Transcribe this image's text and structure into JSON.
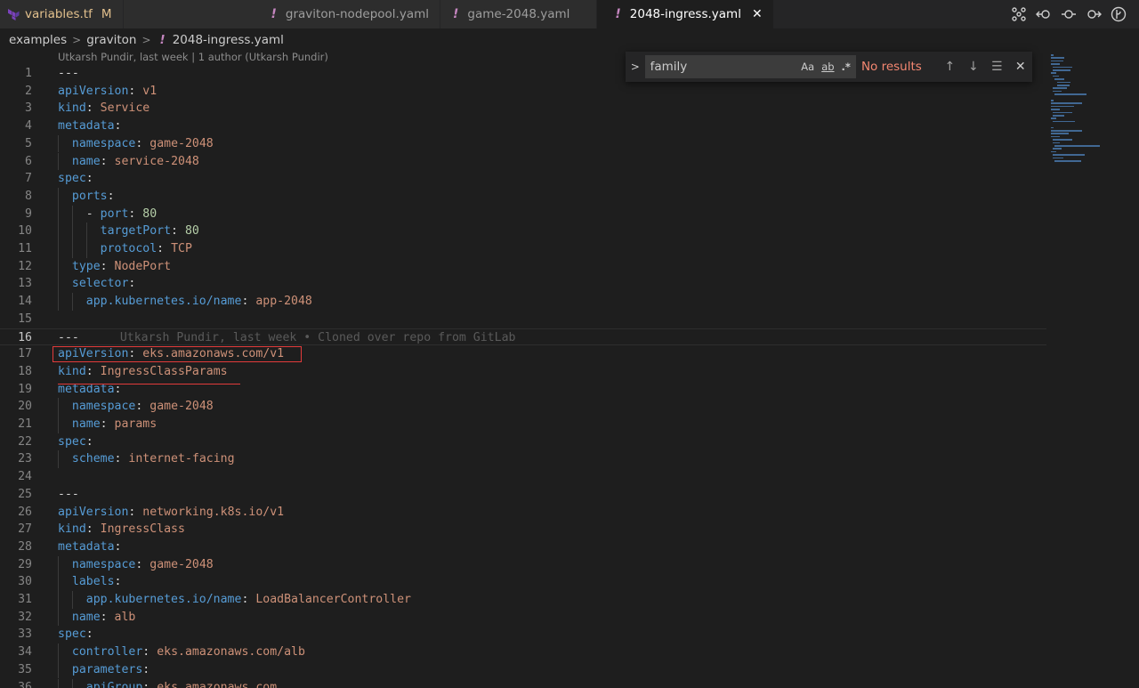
{
  "tabs": [
    {
      "title": "variables.tf",
      "status": "M",
      "icon": "terraform-icon"
    },
    {
      "title": "graviton-nodepool.yaml",
      "icon": "yaml-icon"
    },
    {
      "title": "game-2048.yaml",
      "icon": "yaml-icon"
    },
    {
      "title": "2048-ingress.yaml",
      "icon": "yaml-icon",
      "active": true
    }
  ],
  "tab_tools": [
    "compare-icon",
    "go-back-icon",
    "commit-icon",
    "go-forward-icon",
    "git-branch-icon"
  ],
  "breadcrumb": {
    "items": [
      "examples",
      "graviton",
      "2048-ingress.yaml"
    ]
  },
  "blame_header": "Utkarsh Pundir, last week | 1 author (Utkarsh Pundir)",
  "inline_blame": "Utkarsh Pundir, last week • Cloned over repo from GitLab",
  "find_widget": {
    "query": "family",
    "match_case_label": "Aa",
    "whole_word_label": "ab",
    "regex_label": ".*",
    "result": "No results"
  },
  "colors": {
    "keyword": "#569cd6",
    "string": "#ce9178",
    "number": "#b5cea8",
    "annotation": "#e23b3b"
  },
  "code": [
    {
      "n": "1",
      "parts": [
        {
          "t": "---",
          "c": "d"
        }
      ]
    },
    {
      "n": "2",
      "parts": [
        {
          "t": "apiVersion",
          "c": "k"
        },
        {
          "t": ": ",
          "c": "p"
        },
        {
          "t": "v1",
          "c": "s"
        }
      ]
    },
    {
      "n": "3",
      "parts": [
        {
          "t": "kind",
          "c": "k"
        },
        {
          "t": ": ",
          "c": "p"
        },
        {
          "t": "Service",
          "c": "s"
        }
      ]
    },
    {
      "n": "4",
      "parts": [
        {
          "t": "metadata",
          "c": "k"
        },
        {
          "t": ":",
          "c": "p"
        }
      ]
    },
    {
      "n": "5",
      "parts": [
        {
          "t": "  ",
          "c": "p"
        },
        {
          "t": "namespace",
          "c": "k"
        },
        {
          "t": ": ",
          "c": "p"
        },
        {
          "t": "game-2048",
          "c": "s"
        }
      ]
    },
    {
      "n": "6",
      "parts": [
        {
          "t": "  ",
          "c": "p"
        },
        {
          "t": "name",
          "c": "k"
        },
        {
          "t": ": ",
          "c": "p"
        },
        {
          "t": "service-2048",
          "c": "s"
        }
      ]
    },
    {
      "n": "7",
      "parts": [
        {
          "t": "spec",
          "c": "k"
        },
        {
          "t": ":",
          "c": "p"
        }
      ]
    },
    {
      "n": "8",
      "parts": [
        {
          "t": "  ",
          "c": "p"
        },
        {
          "t": "ports",
          "c": "k"
        },
        {
          "t": ":",
          "c": "p"
        }
      ]
    },
    {
      "n": "9",
      "parts": [
        {
          "t": "    - ",
          "c": "p"
        },
        {
          "t": "port",
          "c": "k"
        },
        {
          "t": ": ",
          "c": "p"
        },
        {
          "t": "80",
          "c": "n"
        }
      ]
    },
    {
      "n": "10",
      "parts": [
        {
          "t": "      ",
          "c": "p"
        },
        {
          "t": "targetPort",
          "c": "k"
        },
        {
          "t": ": ",
          "c": "p"
        },
        {
          "t": "80",
          "c": "n"
        }
      ]
    },
    {
      "n": "11",
      "parts": [
        {
          "t": "      ",
          "c": "p"
        },
        {
          "t": "protocol",
          "c": "k"
        },
        {
          "t": ": ",
          "c": "p"
        },
        {
          "t": "TCP",
          "c": "s"
        }
      ]
    },
    {
      "n": "12",
      "parts": [
        {
          "t": "  ",
          "c": "p"
        },
        {
          "t": "type",
          "c": "k"
        },
        {
          "t": ": ",
          "c": "p"
        },
        {
          "t": "NodePort",
          "c": "s"
        }
      ]
    },
    {
      "n": "13",
      "parts": [
        {
          "t": "  ",
          "c": "p"
        },
        {
          "t": "selector",
          "c": "k"
        },
        {
          "t": ":",
          "c": "p"
        }
      ]
    },
    {
      "n": "14",
      "parts": [
        {
          "t": "    ",
          "c": "p"
        },
        {
          "t": "app.kubernetes.io/name",
          "c": "k"
        },
        {
          "t": ": ",
          "c": "p"
        },
        {
          "t": "app-2048",
          "c": "s"
        }
      ]
    },
    {
      "n": "15",
      "parts": []
    },
    {
      "n": "16",
      "parts": [
        {
          "t": "---",
          "c": "d"
        }
      ],
      "current": true
    },
    {
      "n": "17",
      "parts": [
        {
          "t": "apiVersion",
          "c": "k"
        },
        {
          "t": ": ",
          "c": "p"
        },
        {
          "t": "eks.amazonaws.com/v1",
          "c": "s"
        }
      ]
    },
    {
      "n": "18",
      "parts": [
        {
          "t": "kind",
          "c": "k"
        },
        {
          "t": ": ",
          "c": "p"
        },
        {
          "t": "IngressClassParams",
          "c": "s"
        }
      ]
    },
    {
      "n": "19",
      "parts": [
        {
          "t": "metadata",
          "c": "k"
        },
        {
          "t": ":",
          "c": "p"
        }
      ]
    },
    {
      "n": "20",
      "parts": [
        {
          "t": "  ",
          "c": "p"
        },
        {
          "t": "namespace",
          "c": "k"
        },
        {
          "t": ": ",
          "c": "p"
        },
        {
          "t": "game-2048",
          "c": "s"
        }
      ]
    },
    {
      "n": "21",
      "parts": [
        {
          "t": "  ",
          "c": "p"
        },
        {
          "t": "name",
          "c": "k"
        },
        {
          "t": ": ",
          "c": "p"
        },
        {
          "t": "params",
          "c": "s"
        }
      ]
    },
    {
      "n": "22",
      "parts": [
        {
          "t": "spec",
          "c": "k"
        },
        {
          "t": ":",
          "c": "p"
        }
      ]
    },
    {
      "n": "23",
      "parts": [
        {
          "t": "  ",
          "c": "p"
        },
        {
          "t": "scheme",
          "c": "k"
        },
        {
          "t": ": ",
          "c": "p"
        },
        {
          "t": "internet-facing",
          "c": "s"
        }
      ]
    },
    {
      "n": "24",
      "parts": []
    },
    {
      "n": "25",
      "parts": [
        {
          "t": "---",
          "c": "d"
        }
      ]
    },
    {
      "n": "26",
      "parts": [
        {
          "t": "apiVersion",
          "c": "k"
        },
        {
          "t": ": ",
          "c": "p"
        },
        {
          "t": "networking.k8s.io/v1",
          "c": "s"
        }
      ]
    },
    {
      "n": "27",
      "parts": [
        {
          "t": "kind",
          "c": "k"
        },
        {
          "t": ": ",
          "c": "p"
        },
        {
          "t": "IngressClass",
          "c": "s"
        }
      ]
    },
    {
      "n": "28",
      "parts": [
        {
          "t": "metadata",
          "c": "k"
        },
        {
          "t": ":",
          "c": "p"
        }
      ]
    },
    {
      "n": "29",
      "parts": [
        {
          "t": "  ",
          "c": "p"
        },
        {
          "t": "namespace",
          "c": "k"
        },
        {
          "t": ": ",
          "c": "p"
        },
        {
          "t": "game-2048",
          "c": "s"
        }
      ]
    },
    {
      "n": "30",
      "parts": [
        {
          "t": "  ",
          "c": "p"
        },
        {
          "t": "labels",
          "c": "k"
        },
        {
          "t": ":",
          "c": "p"
        }
      ]
    },
    {
      "n": "31",
      "parts": [
        {
          "t": "    ",
          "c": "p"
        },
        {
          "t": "app.kubernetes.io/name",
          "c": "k"
        },
        {
          "t": ": ",
          "c": "p"
        },
        {
          "t": "LoadBalancerController",
          "c": "s"
        }
      ]
    },
    {
      "n": "32",
      "parts": [
        {
          "t": "  ",
          "c": "p"
        },
        {
          "t": "name",
          "c": "k"
        },
        {
          "t": ": ",
          "c": "p"
        },
        {
          "t": "alb",
          "c": "s"
        }
      ]
    },
    {
      "n": "33",
      "parts": [
        {
          "t": "spec",
          "c": "k"
        },
        {
          "t": ":",
          "c": "p"
        }
      ]
    },
    {
      "n": "34",
      "parts": [
        {
          "t": "  ",
          "c": "p"
        },
        {
          "t": "controller",
          "c": "k"
        },
        {
          "t": ": ",
          "c": "p"
        },
        {
          "t": "eks.amazonaws.com/alb",
          "c": "s"
        }
      ]
    },
    {
      "n": "35",
      "parts": [
        {
          "t": "  ",
          "c": "p"
        },
        {
          "t": "parameters",
          "c": "k"
        },
        {
          "t": ":",
          "c": "p"
        }
      ]
    },
    {
      "n": "36",
      "parts": [
        {
          "t": "    ",
          "c": "p"
        },
        {
          "t": "apiGroup",
          "c": "k"
        },
        {
          "t": ": ",
          "c": "p"
        },
        {
          "t": "eks.amazonaws.com",
          "c": "s"
        }
      ]
    }
  ]
}
